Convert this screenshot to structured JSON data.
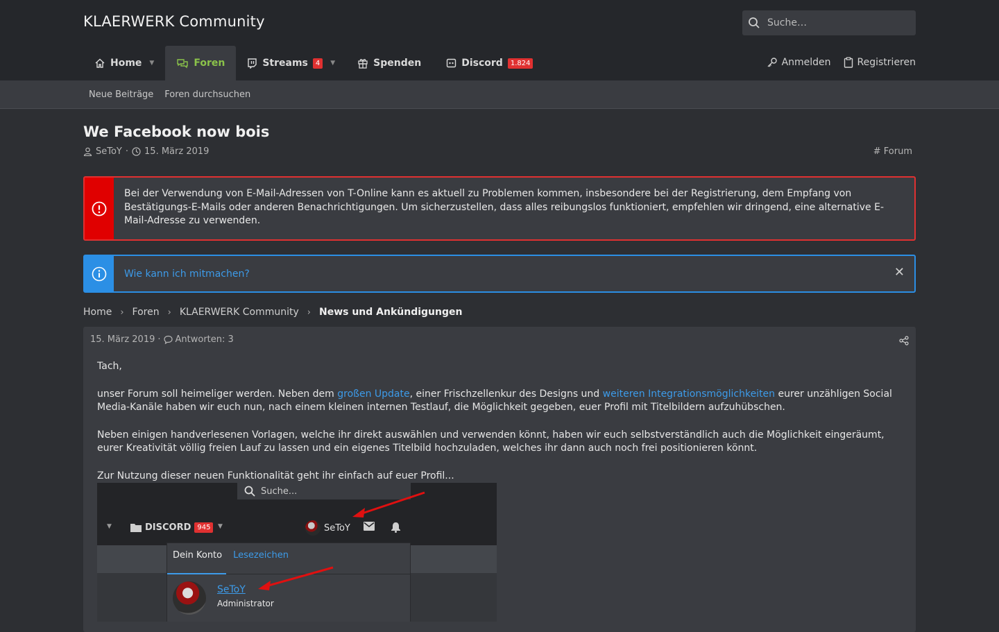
{
  "site": {
    "title": "KLAERWERK Community"
  },
  "search": {
    "placeholder": "Suche…"
  },
  "nav": {
    "items": [
      {
        "label": "Home",
        "icon": "home-icon",
        "active": false,
        "dropdown": true
      },
      {
        "label": "Foren",
        "icon": "chat-icon",
        "active": true,
        "dropdown": false
      },
      {
        "label": "Streams",
        "icon": "twitch-icon",
        "badge": "4",
        "dropdown": true
      },
      {
        "label": "Spenden",
        "icon": "gift-icon",
        "dropdown": false
      },
      {
        "label": "Discord",
        "icon": "discord-icon",
        "badge": "1.824",
        "dropdown": false
      }
    ],
    "login": "Anmelden",
    "register": "Registrieren"
  },
  "subnav": {
    "items": [
      "Neue Beiträge",
      "Foren durchsuchen"
    ]
  },
  "thread": {
    "title": "We Facebook now bois",
    "author": "SeToY",
    "date": "15. März 2019",
    "forum_tag": "Forum"
  },
  "notices": {
    "red": "Bei der Verwendung von E-Mail-Adressen von T-Online  kann es aktuell zu Problemen kommen, insbesondere bei der Registrierung, dem Empfang von Bestätigungs-E-Mails oder anderen Benachrichtigungen. Um sicherzustellen, dass alles reibungslos funktioniert, empfehlen wir dringend, eine alternative E-Mail-Adresse zu verwenden.",
    "blue_link": "Wie kann ich mitmachen?",
    "close": "✕"
  },
  "breadcrumb": {
    "items": [
      "Home",
      "Foren",
      "KLAERWERK Community"
    ],
    "current": "News und Ankündigungen",
    "separator": "›"
  },
  "post": {
    "date": "15. März 2019",
    "replies_label": "Antworten: 3",
    "greeting": "Tach,",
    "p1_a": "unser Forum soll heimeliger werden. Neben dem ",
    "p1_link1": "großen Update",
    "p1_b": ", einer Frischzellenkur des Designs und ",
    "p1_link2": "weiteren Integrationsmöglichkeiten",
    "p1_c": " eurer unzähligen Social Media-Kanäle haben wir euch nun, nach einem kleinen internen Testlauf, die Möglichkeit gegeben, euer Profil mit Titelbildern aufzuhübschen.",
    "p2": "Neben einigen handverlesenen Vorlagen, welche ihr direkt auswählen und verwenden könnt, haben wir euch selbstverständlich auch die Möglichkeit eingeräumt, eurer Kreativität völlig freien Lauf zu lassen und ein eigenes Titelbild hochzuladen, welches ihr dann auch noch frei positionieren könnt.",
    "p3": "Zur Nutzung dieser neuen Funktionalität geht ihr einfach auf euer Profil..."
  },
  "screenshot": {
    "search": "Suche...",
    "discord": "DISCORD",
    "discord_badge": "945",
    "user": "SeToY",
    "tab1": "Dein Konto",
    "tab2": "Lesezeichen",
    "uname": "SeToY",
    "role": "Administrator"
  },
  "colors": {
    "accent_green": "#8bc34a",
    "link_blue": "#3d9be9",
    "alert_red": "#e03131",
    "info_blue": "#2b8fe5",
    "header_bg": "#25272b",
    "panel_bg": "#3a3c41"
  }
}
